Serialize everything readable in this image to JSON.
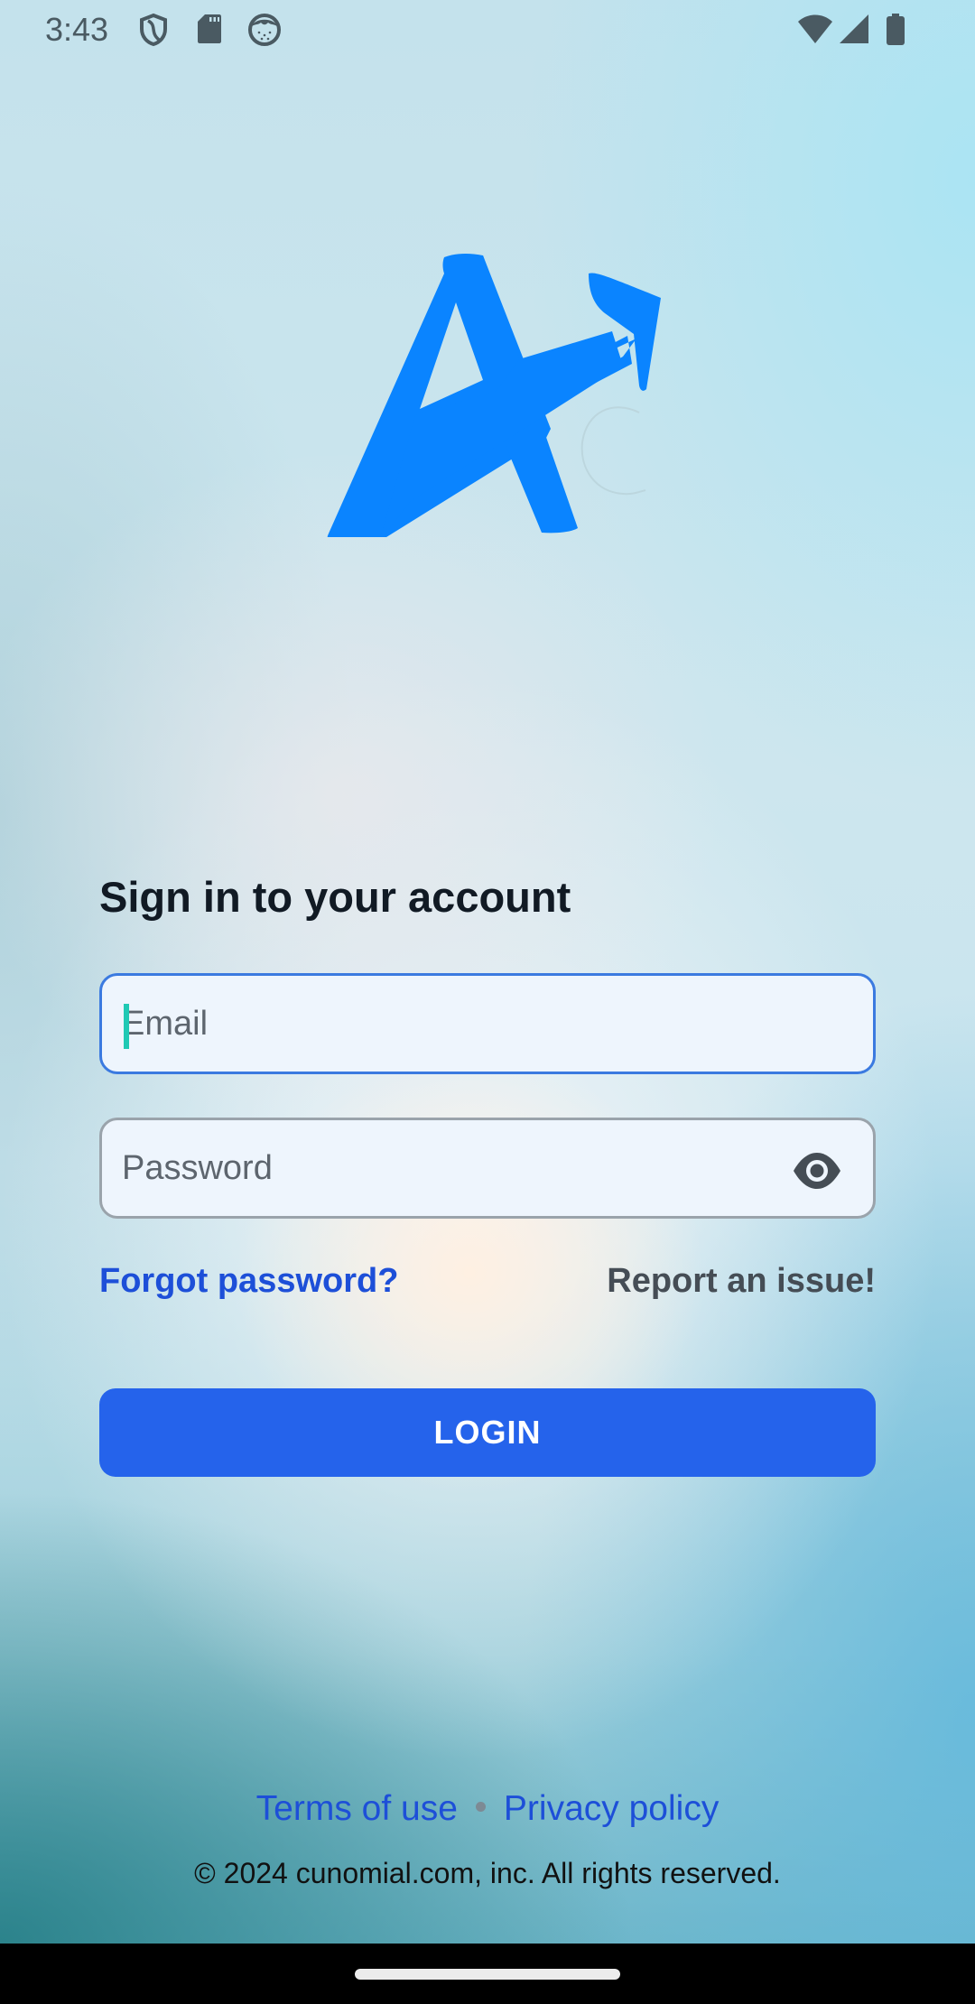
{
  "status_bar": {
    "time": "3:43",
    "left_icons": [
      "shield-icon",
      "sd-card-icon",
      "cat-face-icon"
    ],
    "right_icons": [
      "wifi-icon",
      "cellular-signal-icon",
      "battery-icon"
    ]
  },
  "logo": {
    "name": "A-arrow logo",
    "color": "#0a84ff"
  },
  "form": {
    "heading": "Sign in to your account",
    "email": {
      "placeholder": "Email",
      "value": ""
    },
    "password": {
      "placeholder": "Password",
      "value": "",
      "toggle_icon": "eye-icon"
    },
    "forgot_password": "Forgot password?",
    "report_issue": "Report an issue!",
    "login_label": "LOGIN"
  },
  "footer": {
    "terms": "Terms of use",
    "separator": "•",
    "privacy": "Privacy policy",
    "copyright": "© 2024 cunomial.com, inc. All rights reserved."
  },
  "colors": {
    "primary": "#2563eb",
    "link": "#1d4fd8",
    "logo": "#0a84ff",
    "focused_border": "#3b7ae0",
    "caret": "#1fc9b4"
  }
}
